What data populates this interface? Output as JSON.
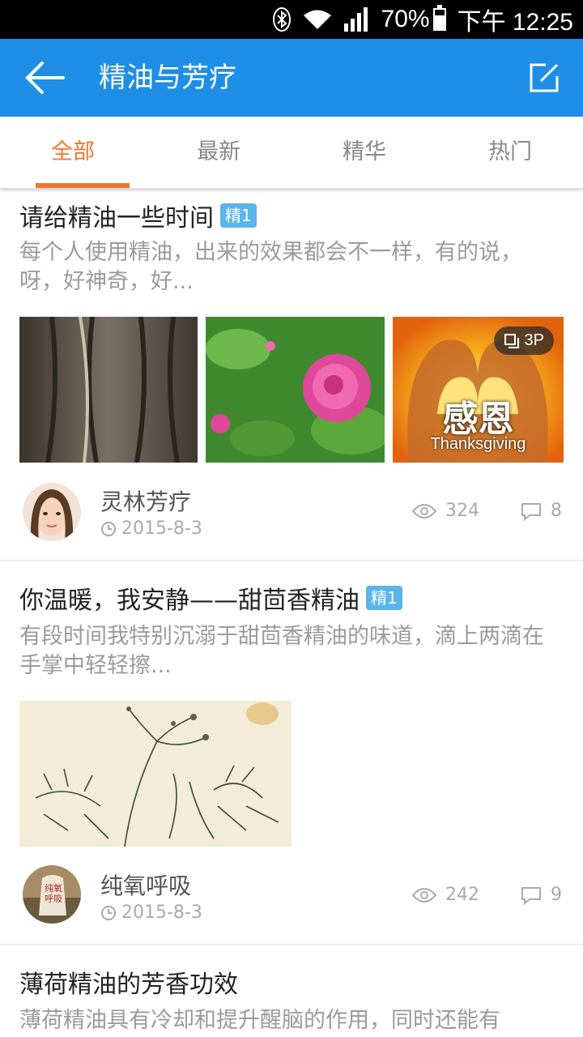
{
  "status_bar": {
    "battery": "70%",
    "time": "下午 12:25",
    "icons": [
      "bluetooth-icon",
      "wifi-icon",
      "signal-icon",
      "battery-icon"
    ]
  },
  "app_bar": {
    "title": "精油与芳疗",
    "back_icon": "arrow-left-icon",
    "compose_icon": "compose-icon"
  },
  "tabs": [
    {
      "label": "全部",
      "active": true
    },
    {
      "label": "最新",
      "active": false
    },
    {
      "label": "精华",
      "active": false
    },
    {
      "label": "热门",
      "active": false
    }
  ],
  "posts": [
    {
      "title": "请给精油一些时间",
      "badge": "精1",
      "desc": "每个人使用精油，出来的效果都会不一样，有的说，呀，好神奇，好...",
      "image_count_badge": "3P",
      "image_texts": [
        "感恩",
        "Thanksgiving"
      ],
      "author": "灵林芳疗",
      "date": "2015-8-3",
      "views": "324",
      "comments": "8"
    },
    {
      "title": "你温暖，我安静——甜茴香精油",
      "badge": "精1",
      "desc": "有段时间我特别沉溺于甜茴香精油的味道，滴上两滴在手掌中轻轻擦...",
      "author": "纯氧呼吸",
      "avatar_text": "纯氧呼吸",
      "date": "2015-8-3",
      "views": "242",
      "comments": "9"
    },
    {
      "title": "薄荷精油的芳香功效",
      "desc": "薄荷精油具有冷却和提升醒脑的作用，同时还能有"
    }
  ],
  "colors": {
    "app_bar": "#1f8ee6",
    "tab_active": "#f0782b",
    "badge": "#5bb4ec"
  }
}
